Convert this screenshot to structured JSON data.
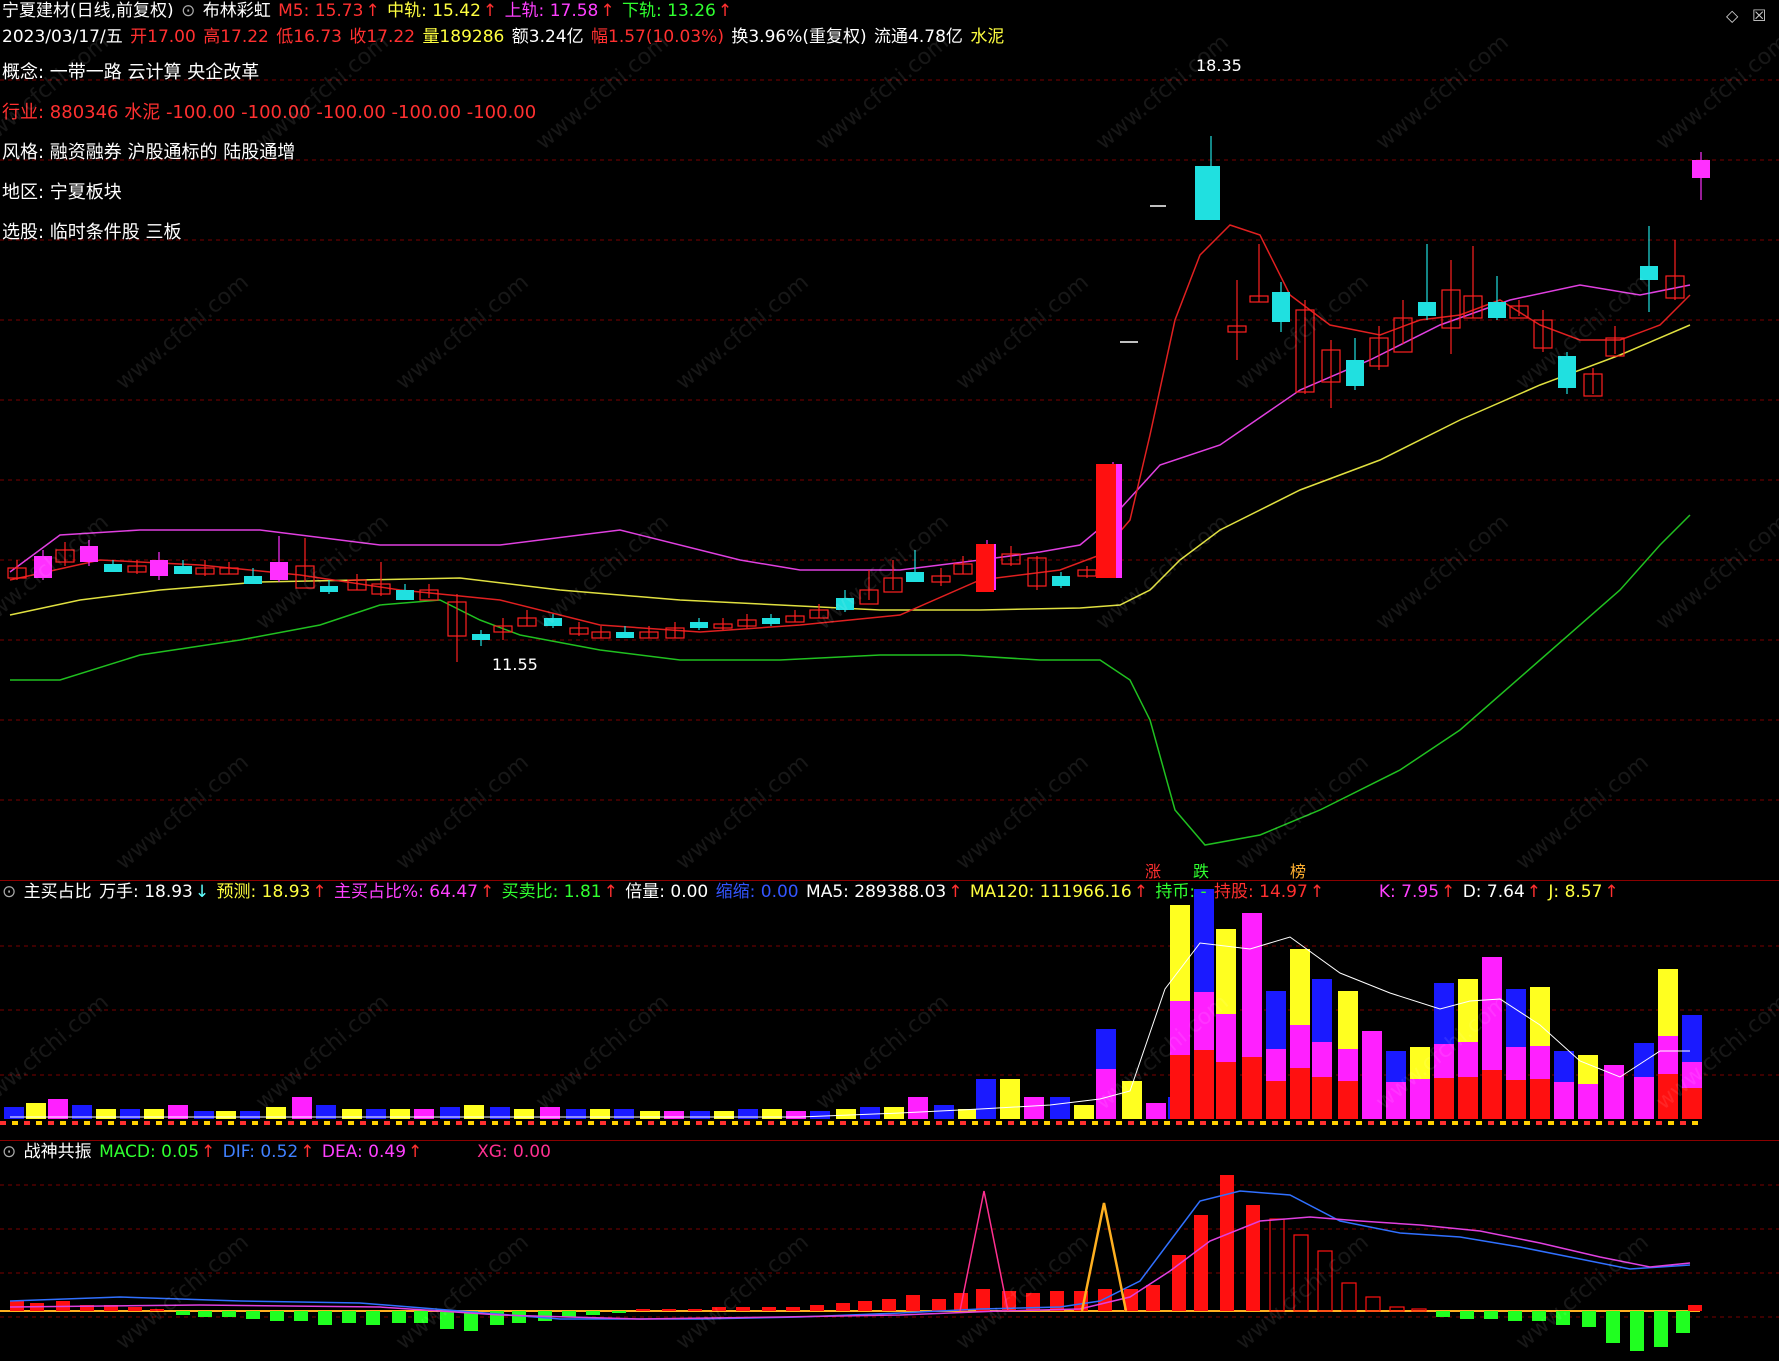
{
  "header": {
    "stock_name": "宁夏建材(日线,前复权)",
    "indicator": "布林彩虹",
    "m5_label": "M5: 15.73",
    "mid_label": "中轨: 15.42",
    "upper_label": "上轨: 17.58",
    "lower_label": "下轨: 13.26",
    "arrow_up": "↑"
  },
  "quote": {
    "date": "2023/03/17/五",
    "open": "开17.00",
    "high": "高17.22",
    "low": "低16.73",
    "close": "收17.22",
    "volume": "量189286",
    "amount": "额3.24亿",
    "change": "幅1.57(10.03%)",
    "turnover": "换3.96%(重复权)",
    "float": "流通4.78亿",
    "sector": "水泥"
  },
  "info": {
    "concept": "概念: 一带一路 云计算 央企改革",
    "industry": "行业: 880346 水泥 -100.00 -100.00 -100.00 -100.00 -100.00",
    "style": "风格: 融资融券 沪股通标的 陆股通增",
    "region": "地区: 宁夏板块",
    "selection": "选股: 临时条件股 三板"
  },
  "price_marks": {
    "high_mark": "18.35",
    "low_mark": "11.55"
  },
  "bottom_tags": {
    "rise": "涨",
    "fall": "跌",
    "rank": "榜"
  },
  "vol_header": {
    "name": "主买占比",
    "wanshou": "万手: 18.93",
    "wanshou_arrow": "↓",
    "forecast": "预测: 18.93",
    "ratio": "主买占比%: 64.47",
    "buysell": "买卖比: 1.81",
    "beiliang": "倍量: 0.00",
    "suoliang": "缩缩: 0.00",
    "ma5": "MA5: 289388.03",
    "ma120": "MA120: 111966.16",
    "hold_coin": "持币: -",
    "hold_stock": "持股: 14.97",
    "k": "K: 7.95",
    "d": "D: 7.64",
    "j": "J: 8.57",
    "arrow_up": "↑"
  },
  "macd_header": {
    "name": "战神共振",
    "macd": "MACD: 0.05",
    "dif": "DIF: 0.52",
    "dea": "DEA: 0.49",
    "xg": "XG: 0.00",
    "arrow_up": "↑"
  },
  "watermark": "www.cfchi.com",
  "colors": {
    "up": "#ff2020",
    "down": "#20e0e0",
    "upper_band": "#e040e0",
    "mid_band": "#e0e040",
    "lower_band": "#20c020",
    "m5": "#e02020",
    "vol_blue": "#1a1aff",
    "vol_yellow": "#ffff20",
    "vol_magenta": "#ff20ff",
    "vol_red": "#ff1010"
  }
}
